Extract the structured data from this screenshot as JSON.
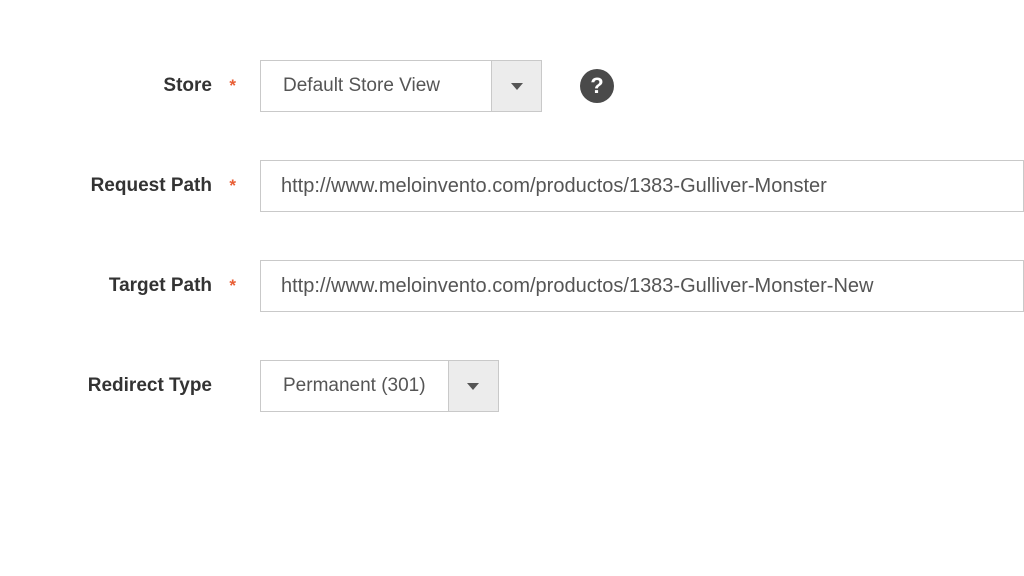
{
  "store": {
    "label": "Store",
    "required": true,
    "value": "Default Store View"
  },
  "request_path": {
    "label": "Request Path",
    "required": true,
    "value": "http://www.meloinvento.com/productos/1383-Gulliver-Monster"
  },
  "target_path": {
    "label": "Target Path",
    "required": true,
    "value": "http://www.meloinvento.com/productos/1383-Gulliver-Monster-New"
  },
  "redirect_type": {
    "label": "Redirect Type",
    "required": false,
    "value": "Permanent (301)"
  }
}
